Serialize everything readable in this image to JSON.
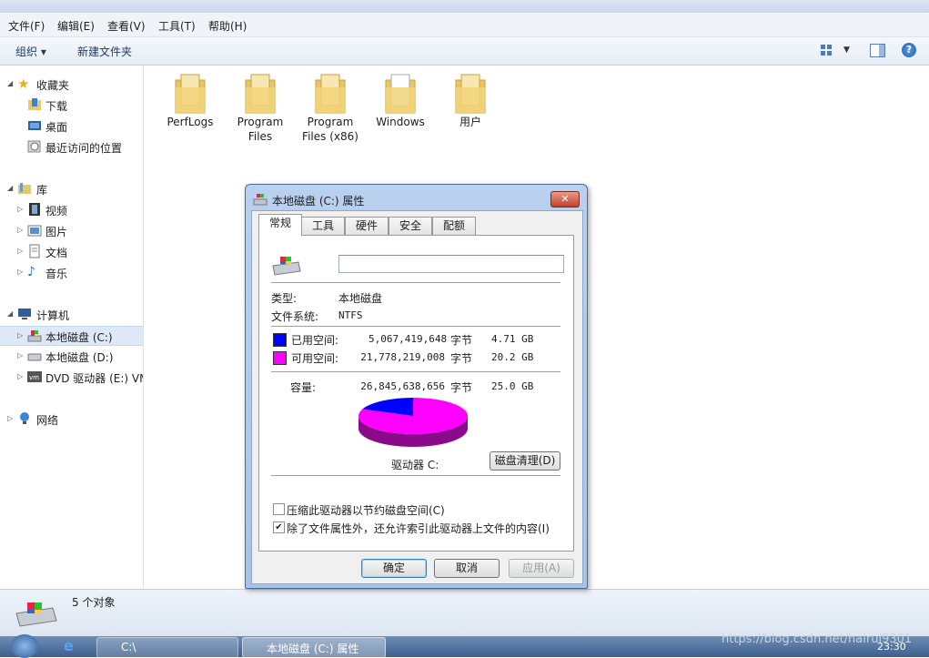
{
  "menu": [
    "文件(F)",
    "编辑(E)",
    "查看(V)",
    "工具(T)",
    "帮助(H)"
  ],
  "toolbar": {
    "organize": "组织 ▾",
    "new_folder": "新建文件夹"
  },
  "nav": {
    "favorites": "收藏夹",
    "downloads": "下载",
    "desktop": "桌面",
    "recent": "最近访问的位置",
    "libraries": "库",
    "videos": "视频",
    "pictures": "图片",
    "documents": "文档",
    "music": "音乐",
    "computer": "计算机",
    "drive_c": "本地磁盘 (C:)",
    "drive_d": "本地磁盘 (D:)",
    "drive_e": "DVD 驱动器 (E:) VM",
    "network": "网络"
  },
  "folders": [
    {
      "l1": "PerfLogs",
      "l2": ""
    },
    {
      "l1": "Program",
      "l2": "Files"
    },
    {
      "l1": "Program",
      "l2": "Files (x86)"
    },
    {
      "l1": "Windows",
      "l2": ""
    },
    {
      "l1": "用户",
      "l2": ""
    }
  ],
  "status": {
    "count": "5 个对象"
  },
  "dialog": {
    "title": "本地磁盘 (C:) 属性",
    "tabs": [
      "常规",
      "工具",
      "硬件",
      "安全",
      "配额"
    ],
    "name_value": "",
    "type_label": "类型:",
    "type_value": "本地磁盘",
    "fs_label": "文件系统:",
    "fs_value": "NTFS",
    "used_label": "已用空间:",
    "used_bytes": "5,067,419,648",
    "used_unit": "字节",
    "used_gb": "4.71 GB",
    "free_label": "可用空间:",
    "free_bytes": "21,778,219,008",
    "free_unit": "字节",
    "free_gb": "20.2 GB",
    "cap_label": "容量:",
    "cap_bytes": "26,845,638,656",
    "cap_unit": "字节",
    "cap_gb": "25.0 GB",
    "drive_label": "驱动器 C:",
    "cleanup": "磁盘清理(D)",
    "compress": "压缩此驱动器以节约磁盘空间(C)",
    "index": "除了文件属性外，还允许索引此驱动器上文件的内容(I)",
    "ok": "确定",
    "cancel": "取消",
    "apply": "应用(A)",
    "used_fraction": 0.189,
    "colors": {
      "used": "#0000ff",
      "free": "#ff00ff"
    }
  },
  "taskbar": {
    "item1": "C:\\",
    "item2": "本地磁盘 (C:) 属性",
    "time": "23:30",
    "watermark": "https://blog.csdn.net/hairui9301"
  }
}
